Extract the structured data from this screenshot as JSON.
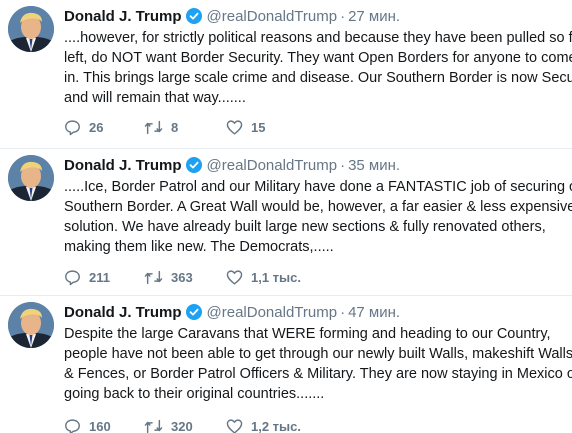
{
  "tweets": [
    {
      "name": "Donald J. Trump",
      "handle": "@realDonaldTrump",
      "separator": "·",
      "time": "27 мин.",
      "lines": [
        "....however, for strictly political reasons and because they have been pulled so far",
        "left, do NOT want Border Security. They want Open Borders for anyone to come",
        "in. This brings large scale crime and disease. Our Southern Border is now Secure",
        "and will remain that way......."
      ],
      "replies": "26",
      "retweets": "8",
      "likes": "15"
    },
    {
      "name": "Donald J. Trump",
      "handle": "@realDonaldTrump",
      "separator": "·",
      "time": "35 мин.",
      "lines": [
        ".....Ice, Border Patrol and our Military have done a FANTASTIC job of securing our",
        "Southern Border. A Great Wall would be, however, a far easier & less expensive",
        "solution. We have already built large new sections & fully renovated others,",
        "making them like new. The Democrats,....."
      ],
      "replies": "211",
      "retweets": "363",
      "likes": "1,1 тыс."
    },
    {
      "name": "Donald J. Trump",
      "handle": "@realDonaldTrump",
      "separator": "·",
      "time": "47 мин.",
      "lines": [
        "Despite the large Caravans that WERE forming and heading to our Country,",
        "people have not been able to get through our newly built Walls, makeshift Walls",
        "& Fences, or Border Patrol Officers & Military. They are now staying in Mexico or",
        "going back to their original countries......."
      ],
      "replies": "160",
      "retweets": "320",
      "likes": "1,2 тыс."
    }
  ],
  "colors": {
    "verified": "#1da1f2",
    "meta": "#657786",
    "text": "#14171a",
    "divider": "#e6ecf0"
  },
  "icons": {
    "reply": "reply-icon",
    "retweet": "retweet-icon",
    "like": "heart-icon",
    "verified": "verified-badge-icon"
  }
}
